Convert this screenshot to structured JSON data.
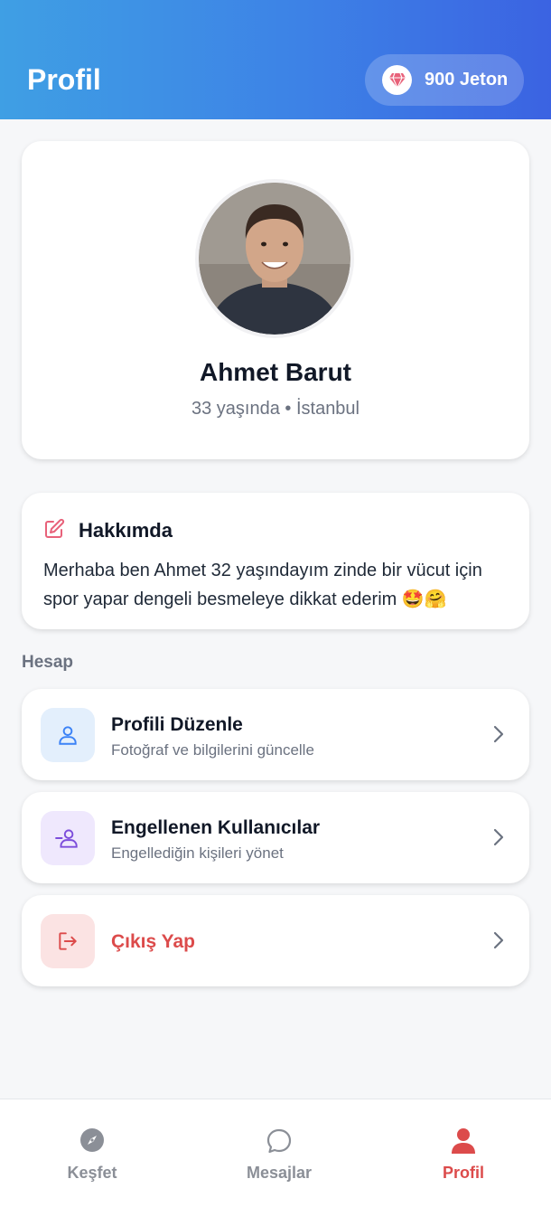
{
  "header": {
    "title": "Profil",
    "coins_label": "900 Jeton"
  },
  "profile": {
    "name": "Ahmet Barut",
    "subline": "33 yaşında • İstanbul"
  },
  "about": {
    "title": "Hakkımda",
    "text": "Merhaba ben Ahmet 32 yaşındayım zinde bir vücut için spor yapar dengeli besmeleye dikkat ederim 🤩🤗"
  },
  "account": {
    "section_label": "Hesap",
    "items": [
      {
        "title": "Profili Düzenle",
        "subtitle": "Fotoğraf ve bilgilerini güncelle",
        "icon": "user-icon"
      },
      {
        "title": "Engellenen Kullanıcılar",
        "subtitle": "Engellediğin kişileri yönet",
        "icon": "user-minus-icon"
      },
      {
        "title": "Çıkış Yap",
        "icon": "logout-icon"
      }
    ]
  },
  "tabs": [
    {
      "label": "Keşfet",
      "icon": "compass-icon"
    },
    {
      "label": "Mesajlar",
      "icon": "chat-bubble-icon"
    },
    {
      "label": "Profil",
      "icon": "person-icon",
      "active": true
    }
  ],
  "colors": {
    "accent_red": "#dc4b4b",
    "header_start": "#3f9fe4",
    "header_end": "#3b63e2"
  }
}
